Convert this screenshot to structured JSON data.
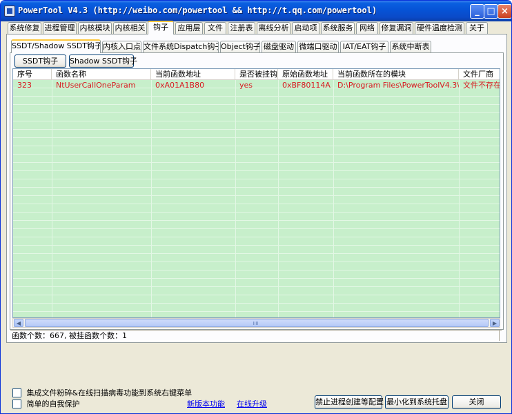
{
  "window": {
    "title": "PowerTool V4.3 (http://weibo.com/powertool && http://t.qq.com/powertool)",
    "minimize_glyph": "_",
    "maximize_glyph": "□",
    "close_glyph": "×"
  },
  "main_tabs": [
    {
      "label": "系统修复"
    },
    {
      "label": "进程管理"
    },
    {
      "label": "内核模块"
    },
    {
      "label": "内核相关"
    },
    {
      "label": "钩子"
    },
    {
      "label": "应用层"
    },
    {
      "label": "文件"
    },
    {
      "label": "注册表"
    },
    {
      "label": "离线分析"
    },
    {
      "label": "启动项"
    },
    {
      "label": "系统服务"
    },
    {
      "label": "网络"
    },
    {
      "label": "修复漏洞"
    },
    {
      "label": "硬件温度检测"
    },
    {
      "label": "关于"
    }
  ],
  "main_active_tab": "钩子",
  "sub_tabs": [
    {
      "label": "SSDT/Shadow SSDT钩子"
    },
    {
      "label": "内核入口点"
    },
    {
      "label": "文件系统Dispatch钩子"
    },
    {
      "label": "Object钩子"
    },
    {
      "label": "磁盘驱动"
    },
    {
      "label": "微端口驱动"
    },
    {
      "label": "IAT/EAT钩子"
    },
    {
      "label": "系统中断表"
    }
  ],
  "sub_active_tab": "SSDT/Shadow SSDT钩子",
  "buttons": {
    "ssdt": "SSDT钩子",
    "shadow_ssdt": "Shadow SSDT钩子"
  },
  "table": {
    "columns": [
      "序号",
      "函数名称",
      "当前函数地址",
      "是否被挂钩",
      "原始函数地址",
      "当前函数所在的模块",
      "文件厂商"
    ],
    "rows": [
      [
        "323",
        "NtUserCallOneParam",
        "0xA01A1B80",
        "yes",
        "0xBF80114A",
        "D:\\Program Files\\PowerToolV4.3\\...",
        "文件不存在"
      ]
    ],
    "hooked_row_color": "#d8191f",
    "row_background": "#c7efcb"
  },
  "scrollbar": {
    "left_arrow": "◀",
    "right_arrow": "▶"
  },
  "status_text": "函数个数：667, 被挂函数个数：1",
  "footer": {
    "checkbox1_label": "集成文件粉碎&在线扫描病毒功能到系统右键菜单",
    "checkbox2_label": "简单的自我保护",
    "link_new_features": "新版本功能",
    "link_online_upgrade": "在线升级",
    "btn_block_process": "禁止进程创建等配置",
    "btn_minimize_tray": "最小化到系统托盘",
    "btn_close": "关闭"
  }
}
